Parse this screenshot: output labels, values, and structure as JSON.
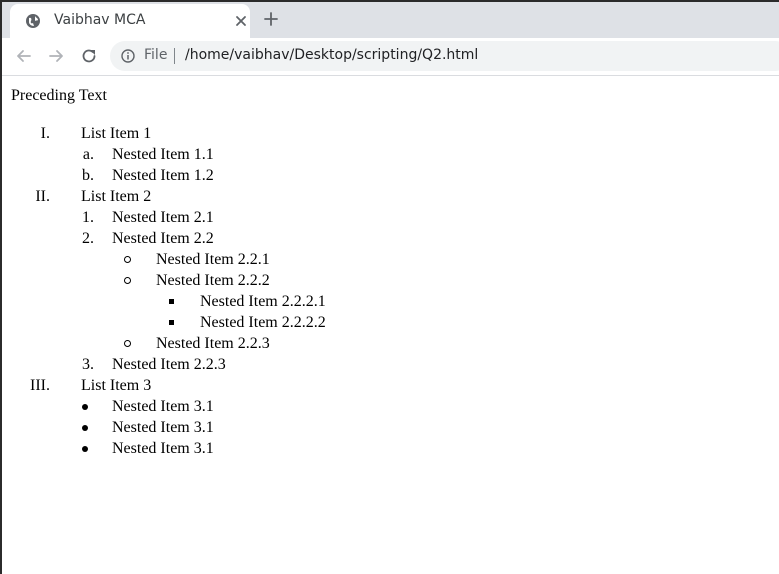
{
  "browser": {
    "tab_title": "Vaibhav MCA",
    "address_scheme": "File",
    "address_url": "/home/vaibhav/Desktop/scripting/Q2.html"
  },
  "page": {
    "preceding_text": "Preceding Text",
    "list": {
      "item1": {
        "marker": "I.",
        "label": "List Item 1",
        "nested": [
          {
            "marker": "a.",
            "label": "Nested Item 1.1"
          },
          {
            "marker": "b.",
            "label": "Nested Item 1.2"
          }
        ]
      },
      "item2": {
        "marker": "II.",
        "label": "List Item 2",
        "nested": [
          {
            "marker": "1.",
            "label": "Nested Item 2.1"
          },
          {
            "marker": "2.",
            "label": "Nested Item 2.2",
            "nested": [
              {
                "label": "Nested Item 2.2.1"
              },
              {
                "label": "Nested Item 2.2.2",
                "nested": [
                  {
                    "label": "Nested Item 2.2.2.1"
                  },
                  {
                    "label": "Nested Item 2.2.2.2"
                  }
                ]
              },
              {
                "label": "Nested Item 2.2.3"
              }
            ]
          },
          {
            "marker": "3.",
            "label": "Nested Item 2.2.3"
          }
        ]
      },
      "item3": {
        "marker": "III.",
        "label": "List Item 3",
        "nested": [
          {
            "label": "Nested Item 3.1"
          },
          {
            "label": "Nested Item 3.1"
          },
          {
            "label": "Nested Item 3.1"
          }
        ]
      }
    }
  }
}
